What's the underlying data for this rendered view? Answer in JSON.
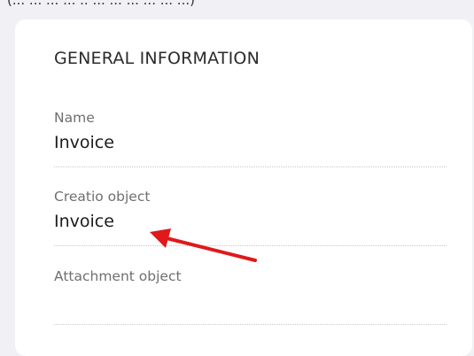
{
  "top_partial_text": "(...  ... ... ... .. ... ... ... ... ... ...)",
  "section": {
    "title": "GENERAL INFORMATION"
  },
  "fields": {
    "name": {
      "label": "Name",
      "value": "Invoice"
    },
    "creatio_object": {
      "label": "Creatio object",
      "value": "Invoice"
    },
    "attachment_object": {
      "label": "Attachment object",
      "value": ""
    }
  },
  "annotation": {
    "arrow_color": "#e0191b"
  }
}
